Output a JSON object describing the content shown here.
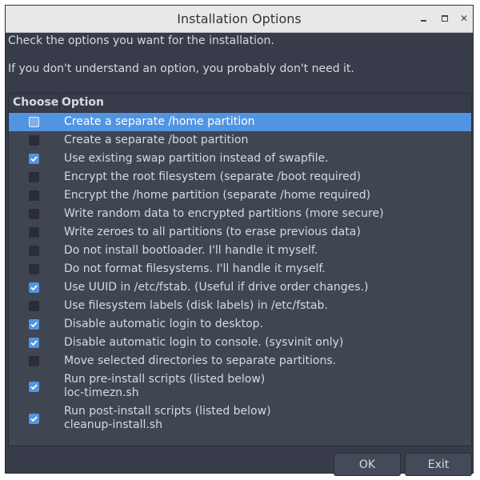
{
  "window": {
    "title": "Installation Options",
    "minimize_icon": "minimize-icon",
    "maximize_icon": "maximize-icon",
    "close_icon": "close-icon"
  },
  "messages": {
    "line1": "Check the options you want for the installation.",
    "line2": "If you don't understand an option, you probably don't need it."
  },
  "columns": {
    "choose": "Choose",
    "option": "Option"
  },
  "options": [
    {
      "label": "Create a separate /home partition",
      "checked": false,
      "selected": true
    },
    {
      "label": "Create a separate /boot partition",
      "checked": false
    },
    {
      "label": "Use existing swap partition instead of swapfile.",
      "checked": true
    },
    {
      "label": "Encrypt the root filesystem (separate /boot required)",
      "checked": false
    },
    {
      "label": "Encrypt the /home partition (separate /home required)",
      "checked": false
    },
    {
      "label": "Write random data to encrypted partitions (more secure)",
      "checked": false
    },
    {
      "label": "Write zeroes to all partitions (to erase previous data)",
      "checked": false
    },
    {
      "label": "Do not install bootloader. I'll handle it myself.",
      "checked": false
    },
    {
      "label": "Do not format filesystems. I'll handle it myself.",
      "checked": false
    },
    {
      "label": "Use UUID in /etc/fstab. (Useful if drive order changes.)",
      "checked": true
    },
    {
      "label": "Use filesystem labels (disk labels) in /etc/fstab.",
      "checked": false
    },
    {
      "label": "Disable automatic login to desktop.",
      "checked": true
    },
    {
      "label": "Disable automatic login to console. (sysvinit only)",
      "checked": true
    },
    {
      "label": "Move selected directories to separate partitions.",
      "checked": false
    },
    {
      "label": "Run pre-install scripts (listed below)",
      "sublabel": "loc-timezn.sh",
      "checked": true
    },
    {
      "label": "Run post-install scripts (listed below)",
      "sublabel": "cleanup-install.sh",
      "checked": true
    }
  ],
  "buttons": {
    "ok": "OK",
    "exit": "Exit"
  },
  "colors": {
    "accent": "#5294e2",
    "window_bg": "#383c4a",
    "list_bg": "#404552",
    "text": "#d3dae3"
  }
}
